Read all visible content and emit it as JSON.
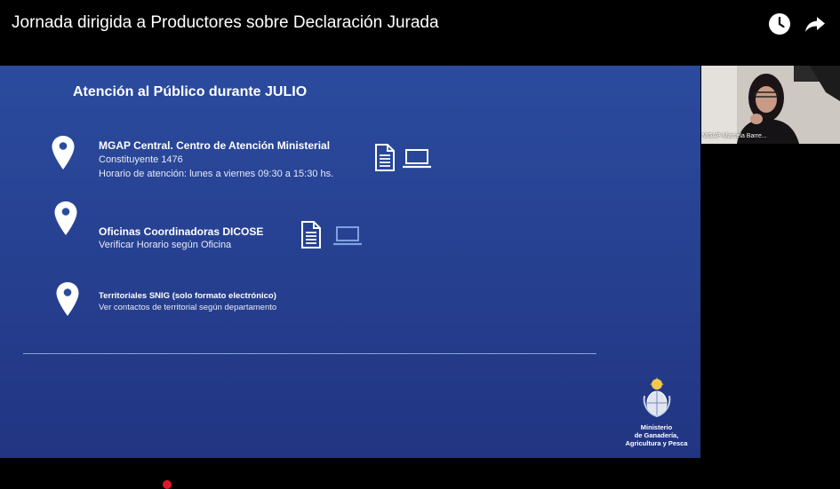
{
  "header": {
    "title": "Jornada dirigida a Productores sobre Declaración Jurada",
    "watch_later_icon": "clock-icon",
    "share_icon": "share-arrow-icon"
  },
  "slide": {
    "heading": "Atención al Público durante JULIO",
    "locations": [
      {
        "name": "MGAP Central. Centro de Atención Ministerial",
        "lines": [
          "Constituyente 1476",
          "Horario de atención: lunes a viernes 09:30 a 15:30 hs."
        ],
        "icons": [
          "document-icon",
          "laptop-icon"
        ]
      },
      {
        "name": "Oficinas Coordinadoras DICOSE",
        "lines": [
          "Verificar Horario según Oficina"
        ],
        "icons": [
          "document-icon",
          "laptop-icon"
        ]
      },
      {
        "name": "Territoriales SNIG (solo formato electrónico)",
        "lines": [
          "Ver contactos de territorial según departamento"
        ],
        "icons": []
      }
    ],
    "ministry": {
      "line1": "Ministerio",
      "line2": "de Ganadería,",
      "line3": "Agricultura y Pesca"
    }
  },
  "webcam": {
    "participant_label": "MGAP-Marcela Barre..."
  },
  "colors": {
    "slide_bg": "#2b4b9e",
    "player_bg": "#000000",
    "progress": "#e01a2a",
    "laptop_muted": "#7fa2e0"
  }
}
